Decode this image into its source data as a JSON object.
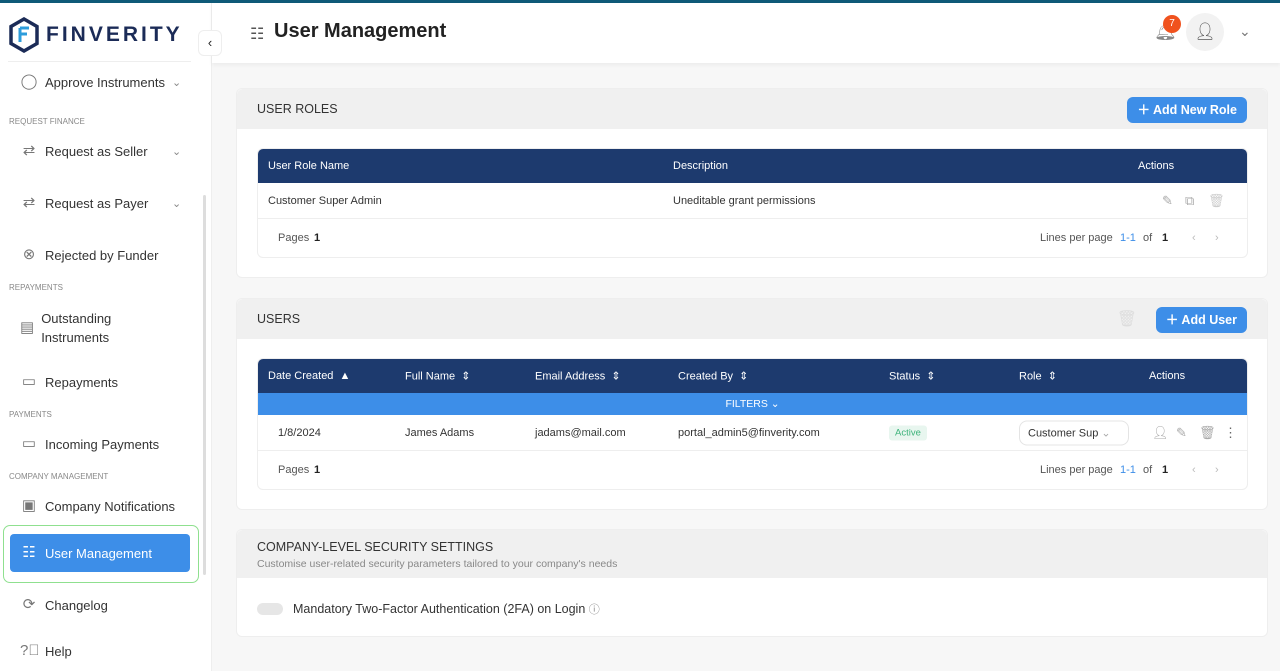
{
  "brand": {
    "name": "FINVERITY"
  },
  "sidebar": {
    "items": [
      {
        "label": "Approve Instruments",
        "icon": "check-circle-icon"
      },
      {
        "section": "REQUEST FINANCE"
      },
      {
        "label": "Request as Seller",
        "icon": "exchange-icon"
      },
      {
        "label": "Request as Payer",
        "icon": "exchange-icon"
      },
      {
        "label": "Rejected by Funder",
        "icon": "x-circle-icon"
      },
      {
        "section": "REPAYMENTS"
      },
      {
        "label": "Outstanding Instruments",
        "icon": "document-icon"
      },
      {
        "label": "Repayments",
        "icon": "wallet-icon"
      },
      {
        "section": "PAYMENTS"
      },
      {
        "label": "Incoming Payments",
        "icon": "wallet-icon"
      },
      {
        "section": "COMPANY MANAGEMENT"
      },
      {
        "label": "Company Notifications",
        "icon": "notification-settings-icon"
      },
      {
        "label": "User Management",
        "icon": "user-settings-icon"
      },
      {
        "label": "Changelog",
        "icon": "refresh-icon"
      },
      {
        "label": "Help",
        "icon": "help-icon"
      }
    ]
  },
  "header": {
    "title": "User Management",
    "notifications": "7"
  },
  "roles": {
    "title": "USER ROLES",
    "add": "Add New Role",
    "columns": [
      "User Role Name",
      "Description",
      "Actions"
    ],
    "rows": [
      {
        "name": "Customer Super Admin",
        "description": "Uneditable grant permissions"
      }
    ],
    "pages_label": "Pages",
    "pages": "1",
    "lines_label": "Lines per page",
    "range": "1-1",
    "of": "of",
    "total": "1"
  },
  "users": {
    "title": "USERS",
    "add": "Add User",
    "columns": [
      "Date Created",
      "Full Name",
      "Email Address",
      "Created By",
      "Status",
      "Role",
      "Actions"
    ],
    "filters": "FILTERS",
    "rows": [
      {
        "date": "1/8/2024",
        "name": "James Adams",
        "email": "jadams@mail.com",
        "created_by": "portal_admin5@finverity.com",
        "status": "Active",
        "role": "Customer Sup"
      }
    ],
    "pages_label": "Pages",
    "pages": "1",
    "lines_label": "Lines per page",
    "range": "1-1",
    "of": "of",
    "total": "1"
  },
  "security": {
    "title": "COMPANY-LEVEL SECURITY SETTINGS",
    "subtitle": "Customise user-related security parameters tailored to your company's needs",
    "twofa": "Mandatory Two-Factor Authentication (2FA) on Login",
    "twofa_enabled": false
  }
}
